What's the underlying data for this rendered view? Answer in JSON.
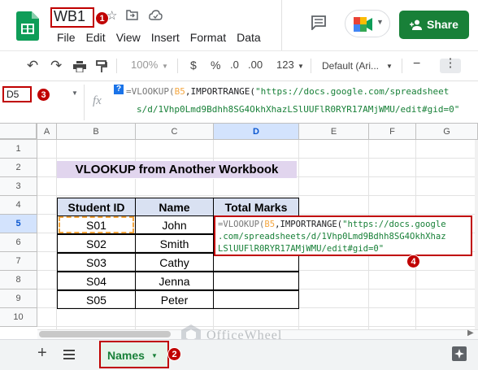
{
  "doc": {
    "title": "WB1"
  },
  "menu": [
    "File",
    "Edit",
    "View",
    "Insert",
    "Format",
    "Data"
  ],
  "share_label": "Share",
  "toolbar": {
    "zoom": "100%",
    "currency": "$",
    "percent": "%",
    "dec_less": ".0",
    "dec_more": ".00",
    "num_format": "123",
    "font": "Default (Ari..."
  },
  "namebox": "D5",
  "formula": {
    "prefix": "=VLOOKUP(",
    "ref": "B5",
    "mid": ",IMPORTRANGE(",
    "str1": "\"https://docs.google.com/spreadsheet",
    "str2": "s/d/1Vhp0Lmd9Bdhh8SG4OkhXhazLSlUUFlR0RYR17AMjWMU/edit#gid=0\""
  },
  "columns": [
    "A",
    "B",
    "C",
    "D",
    "E",
    "F",
    "G"
  ],
  "rows": [
    "1",
    "2",
    "3",
    "4",
    "5",
    "6",
    "7",
    "8",
    "9",
    "10"
  ],
  "sheet_title": "VLOOKUP from Another Workbook",
  "table": {
    "headers": [
      "Student ID",
      "Name",
      "Total Marks"
    ],
    "rows": [
      [
        "S01",
        "John"
      ],
      [
        "S02",
        "Smith"
      ],
      [
        "S03",
        "Cathy"
      ],
      [
        "S04",
        "Jenna"
      ],
      [
        "S05",
        "Peter"
      ]
    ]
  },
  "cell_edit": {
    "prefix": "=VLOOKUP(",
    "ref": "B5",
    "mid": ",IMPORTRANGE(",
    "line1": "\"https://docs.google",
    "line2": ".com/spreadsheets/d/1Vhp0Lmd9Bdhh8SG4OkhXhaz",
    "line3": "LSlUUFlR0RYR17AMjWMU/edit#gid=0\""
  },
  "watermark": "OfficeWheel",
  "sheet_tab": "Names",
  "badges": [
    "1",
    "2",
    "3",
    "4"
  ],
  "colors": {
    "annotation": "#c00000",
    "share": "#188038",
    "header_fill": "#d9e1f2",
    "title_fill": "#e1d5ee",
    "ref": "#f4a640"
  }
}
